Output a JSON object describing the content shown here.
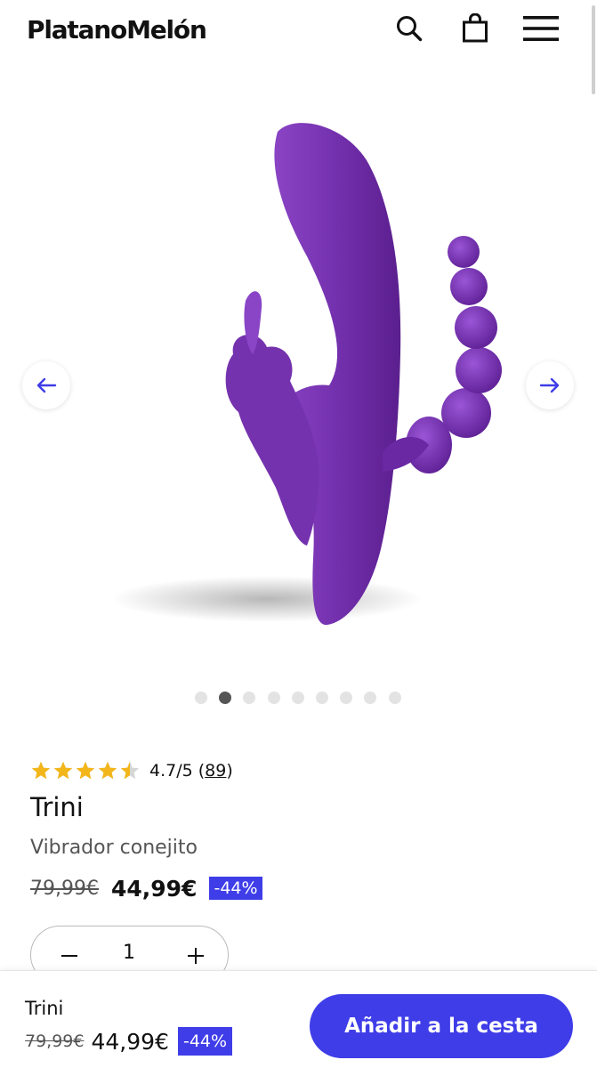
{
  "header": {
    "logo": "PlatanoMelón",
    "icons": [
      "search-icon",
      "bag-icon",
      "menu-icon"
    ]
  },
  "gallery": {
    "image_subject": "purple-rabbit-vibrator",
    "slide_count": 9,
    "active_slide": 2
  },
  "product": {
    "rating_value": "4.7",
    "rating_max": "/5",
    "rating_stars": 4.7,
    "review_count": "89",
    "title": "Trini",
    "subtitle": "Vibrador conejito",
    "old_price": "79,99€",
    "price": "44,99€",
    "discount": "-44%",
    "quantity": "1"
  },
  "sticky_bar": {
    "title": "Trini",
    "old_price": "79,99€",
    "price": "44,99€",
    "discount": "-44%",
    "cta_label": "Añadir a la cesta"
  },
  "colors": {
    "accent": "#3f3de8",
    "product": "#6e2ba6",
    "star": "#f3b61a"
  }
}
